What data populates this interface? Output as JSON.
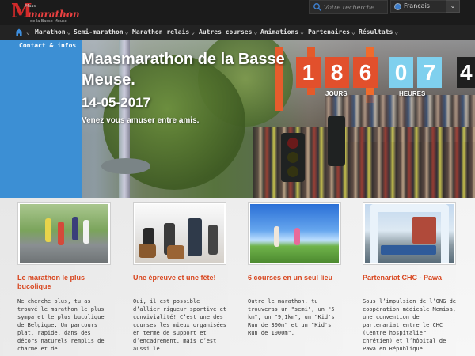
{
  "header": {
    "logo": {
      "line1": "Maas",
      "line2": "marathon",
      "line3": "de la Basse-Meuse"
    },
    "search": {
      "placeholder": "Votre recherche..."
    },
    "language": {
      "selected": "Français"
    }
  },
  "nav": {
    "items": [
      {
        "label": "Marathon"
      },
      {
        "label": "Semi-marathon"
      },
      {
        "label": "Marathon relais"
      },
      {
        "label": "Autres courses"
      },
      {
        "label": "Animations"
      },
      {
        "label": "Partenaires"
      },
      {
        "label": "Résultats"
      }
    ],
    "contact": "Contact & infos"
  },
  "hero": {
    "title": "Maasmarathon de la Basse Meuse.",
    "date": "14-05-2017",
    "subtitle": "Venez vous amuser entre amis.",
    "countdown": {
      "days": [
        "1",
        "8",
        "6"
      ],
      "hours": [
        "0",
        "7"
      ],
      "next": "4",
      "days_label": "JOURS",
      "hours_label": "HEURES"
    }
  },
  "cards": [
    {
      "title": "Le marathon le plus bucolique",
      "body": "Ne cherche plus, tu as trouvé le marathon le plus sympa et le plus bucolique de Belgique. Un parcours plat, rapide, dans des décors naturels remplis de charme et de"
    },
    {
      "title": "Une épreuve et une fête!",
      "body": "Oui, il est possible d’allier rigueur sportive et convivialité! C’est une des courses les mieux organisées en terme de support et d’encadrement, mais c’est aussi le"
    },
    {
      "title": "6 courses en un seul lieu",
      "body": "Outre le marathon, tu trouveras un \"semi\", un \"5 km\", un \"9,1km\", un \"Kid's Run de 300m\" et un \"Kid's Run de 1000m\"."
    },
    {
      "title": "Partenariat CHC - Pawa",
      "body": "Sous l’impulsion de l’ONG de coopération médicale Memisa, une convention de partenariat entre le CHC (Centre hospitalier chrétien) et l’hôpital de Pawa en République"
    }
  ],
  "colors": {
    "accent": "#d8461f",
    "countdown_orange": "#e2502c",
    "countdown_blue": "#7fd0ee",
    "sidebar_blue": "#3c8fd4",
    "topbar": "#1b1b1b"
  },
  "icons": {
    "home": "home-icon",
    "search": "search-icon",
    "globe": "globe-icon",
    "dropdown": "chevron-down-icon"
  }
}
